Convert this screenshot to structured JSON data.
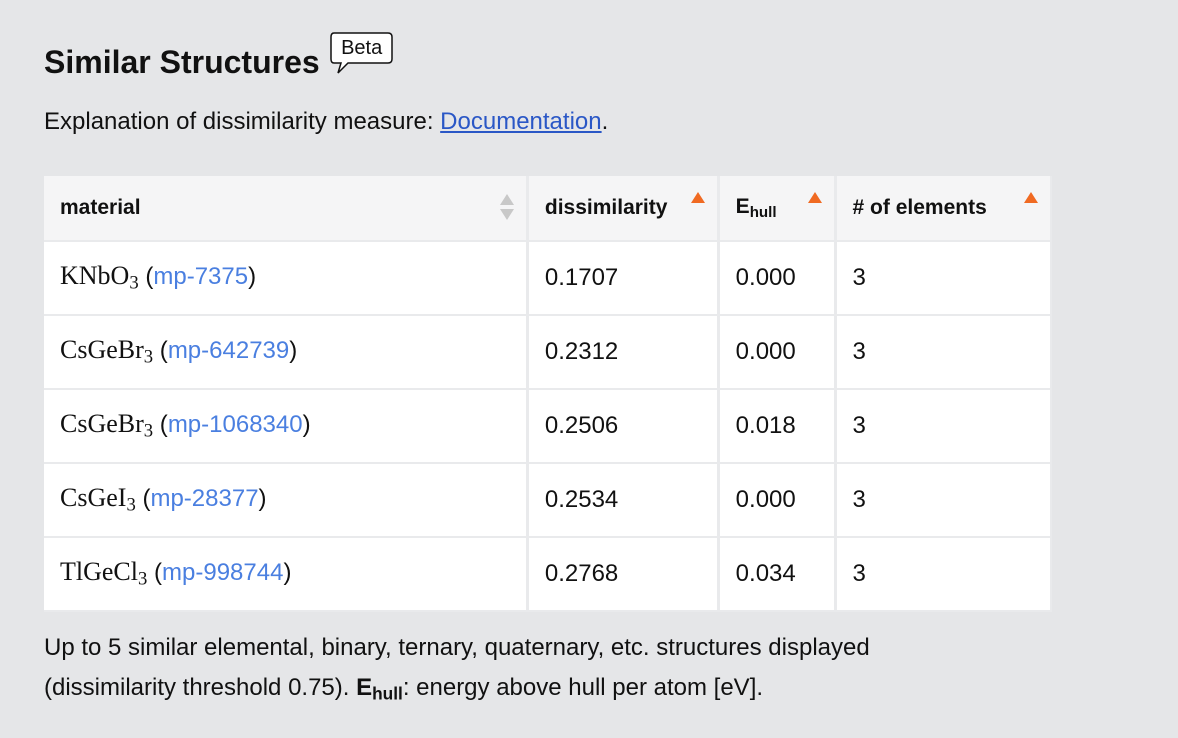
{
  "section": {
    "title": "Similar Structures",
    "badge": "Beta",
    "explanation_prefix": "Explanation of dissimilarity measure: ",
    "explanation_link": "Documentation",
    "explanation_suffix": "."
  },
  "table": {
    "headers": {
      "material": "material",
      "dissimilarity": "dissimilarity",
      "ehull_main": "E",
      "ehull_sub": "hull",
      "elements": "# of elements"
    },
    "rows": [
      {
        "formula": "KNbO",
        "formula_sub": "3",
        "open": " (",
        "id": "mp-7375",
        "close": ")",
        "dissimilarity": "0.1707",
        "ehull": "0.000",
        "elements": "3"
      },
      {
        "formula": "CsGeBr",
        "formula_sub": "3",
        "open": " (",
        "id": "mp-642739",
        "close": ")",
        "dissimilarity": "0.2312",
        "ehull": "0.000",
        "elements": "3"
      },
      {
        "formula": "CsGeBr",
        "formula_sub": "3",
        "open": " (",
        "id": "mp-1068340",
        "close": ")",
        "dissimilarity": "0.2506",
        "ehull": "0.018",
        "elements": "3"
      },
      {
        "formula": "CsGeI",
        "formula_sub": "3",
        "open": " (",
        "id": "mp-28377",
        "close": ")",
        "dissimilarity": "0.2534",
        "ehull": "0.000",
        "elements": "3"
      },
      {
        "formula": "TlGeCl",
        "formula_sub": "3",
        "open": " (",
        "id": "mp-998744",
        "close": ")",
        "dissimilarity": "0.2768",
        "ehull": "0.034",
        "elements": "3"
      }
    ]
  },
  "footnote": {
    "line1": "Up to 5 similar elemental, binary, ternary, quaternary, etc. structures displayed",
    "line2_prefix": "(dissimilarity threshold 0.75). ",
    "bold_main": "E",
    "bold_sub": "hull",
    "line2_suffix": ": energy above hull per atom [eV]."
  },
  "colors": {
    "link": "#4a7fe0",
    "doc_link": "#2a57c6",
    "sort_active": "#f06a22",
    "background": "#e5e6e8"
  }
}
